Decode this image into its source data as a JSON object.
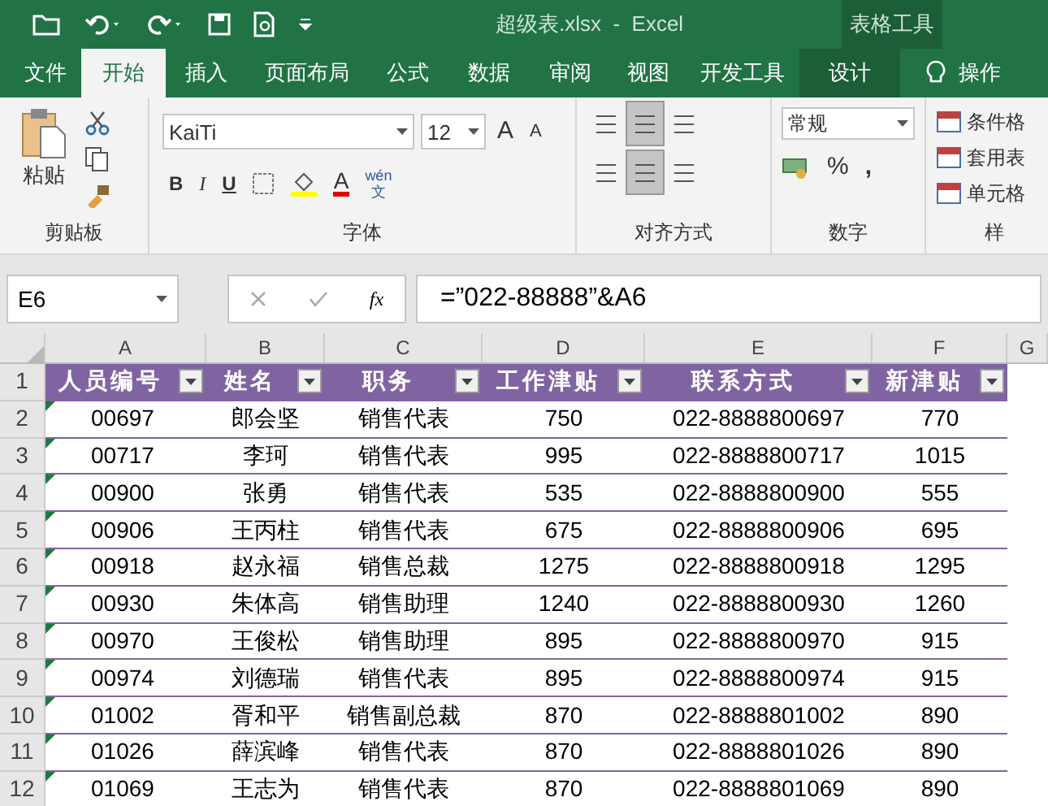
{
  "title_bar": {
    "title": "超级表.xlsx  -  Excel",
    "context_label": "表格工具"
  },
  "ribbon_tabs": [
    {
      "label": "文件",
      "selected": false,
      "contextual": false
    },
    {
      "label": "开始",
      "selected": true,
      "contextual": false
    },
    {
      "label": "插入",
      "selected": false,
      "contextual": false
    },
    {
      "label": "页面布局",
      "selected": false,
      "contextual": false
    },
    {
      "label": "公式",
      "selected": false,
      "contextual": false
    },
    {
      "label": "数据",
      "selected": false,
      "contextual": false
    },
    {
      "label": "审阅",
      "selected": false,
      "contextual": false
    },
    {
      "label": "视图",
      "selected": false,
      "contextual": false
    },
    {
      "label": "开发工具",
      "selected": false,
      "contextual": false
    },
    {
      "label": "设计",
      "selected": false,
      "contextual": true
    }
  ],
  "tell_me": "操作",
  "clipboard": {
    "paste": "粘贴",
    "label": "剪贴板"
  },
  "font": {
    "name": "KaiTi",
    "size": "12",
    "grow": "A",
    "shrink": "A",
    "bold": "B",
    "italic": "I",
    "underline": "U",
    "font_color": "A",
    "phonetic": "wén",
    "phonetic_sub": "文",
    "label": "字体"
  },
  "alignment": {
    "vertical": [
      {
        "selected": false
      },
      {
        "selected": true
      },
      {
        "selected": false
      }
    ],
    "horizontal": [
      {
        "selected": false
      },
      {
        "selected": true
      },
      {
        "selected": false
      }
    ],
    "label": "对齐方式"
  },
  "number": {
    "format": "常规",
    "percent": "%",
    "comma": ",",
    "label": "数字"
  },
  "styles": {
    "items": [
      "条件格",
      "套用表",
      "单元格"
    ],
    "label": "样"
  },
  "name_box": "E6",
  "function_button": "fx",
  "header_row": "1",
  "formula": "=”022-88888”&A6",
  "columns": [
    "A",
    "B",
    "C",
    "D",
    "E",
    "F",
    "G"
  ],
  "header": [
    "人员编号",
    "姓名",
    "职务",
    "工作津贴",
    "联系方式",
    "新津贴"
  ],
  "rows": [
    {
      "n": "2",
      "cells": [
        "00697",
        "郎会坚",
        "销售代表",
        "750",
        "022-8888800697",
        "770"
      ],
      "flag": true
    },
    {
      "n": "3",
      "cells": [
        "00717",
        "李珂",
        "销售代表",
        "995",
        "022-8888800717",
        "1015"
      ],
      "flag": true
    },
    {
      "n": "4",
      "cells": [
        "00900",
        "张勇",
        "销售代表",
        "535",
        "022-8888800900",
        "555"
      ],
      "flag": true
    },
    {
      "n": "5",
      "cells": [
        "00906",
        "王丙柱",
        "销售代表",
        "675",
        "022-8888800906",
        "695"
      ],
      "flag": true
    },
    {
      "n": "6",
      "cells": [
        "00918",
        "赵永福",
        "销售总裁",
        "1275",
        "022-8888800918",
        "1295"
      ],
      "flag": true
    },
    {
      "n": "7",
      "cells": [
        "00930",
        "朱体高",
        "销售助理",
        "1240",
        "022-8888800930",
        "1260"
      ],
      "flag": true
    },
    {
      "n": "8",
      "cells": [
        "00970",
        "王俊松",
        "销售助理",
        "895",
        "022-8888800970",
        "915"
      ],
      "flag": true
    },
    {
      "n": "9",
      "cells": [
        "00974",
        "刘德瑞",
        "销售代表",
        "895",
        "022-8888800974",
        "915"
      ],
      "flag": true
    },
    {
      "n": "10",
      "cells": [
        "01002",
        "胥和平",
        "销售副总裁",
        "870",
        "022-8888801002",
        "890"
      ],
      "flag": true
    },
    {
      "n": "11",
      "cells": [
        "01026",
        "薛滨峰",
        "销售代表",
        "870",
        "022-8888801026",
        "890"
      ],
      "flag": true
    },
    {
      "n": "12",
      "cells": [
        "01069",
        "王志为",
        "销售代表",
        "870",
        "022-8888801069",
        "890"
      ],
      "flag": true
    }
  ]
}
